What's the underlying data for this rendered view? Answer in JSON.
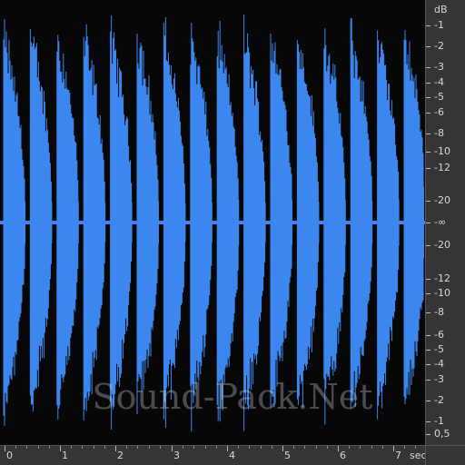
{
  "editor": {
    "waveform_color": "#3b87ef",
    "background_color": "#070707",
    "ruler_background": "#353535",
    "waveform_bursts": 16,
    "watermark": "Sound-Pack.Net"
  },
  "db_scale": {
    "unit": "dB",
    "labels": [
      "-1",
      "-2",
      "-3",
      "-4",
      "-5",
      "-6",
      "-8",
      "-10",
      "-12",
      "-20",
      "-∞",
      "-20",
      "-12",
      "-10",
      "-8",
      "-6",
      "-5",
      "-4",
      "-3",
      "-2",
      "-1",
      "0,5"
    ]
  },
  "time_scale": {
    "unit": "sec",
    "labels": [
      "0",
      "1",
      "2",
      "3",
      "4",
      "5",
      "6",
      "7"
    ]
  }
}
